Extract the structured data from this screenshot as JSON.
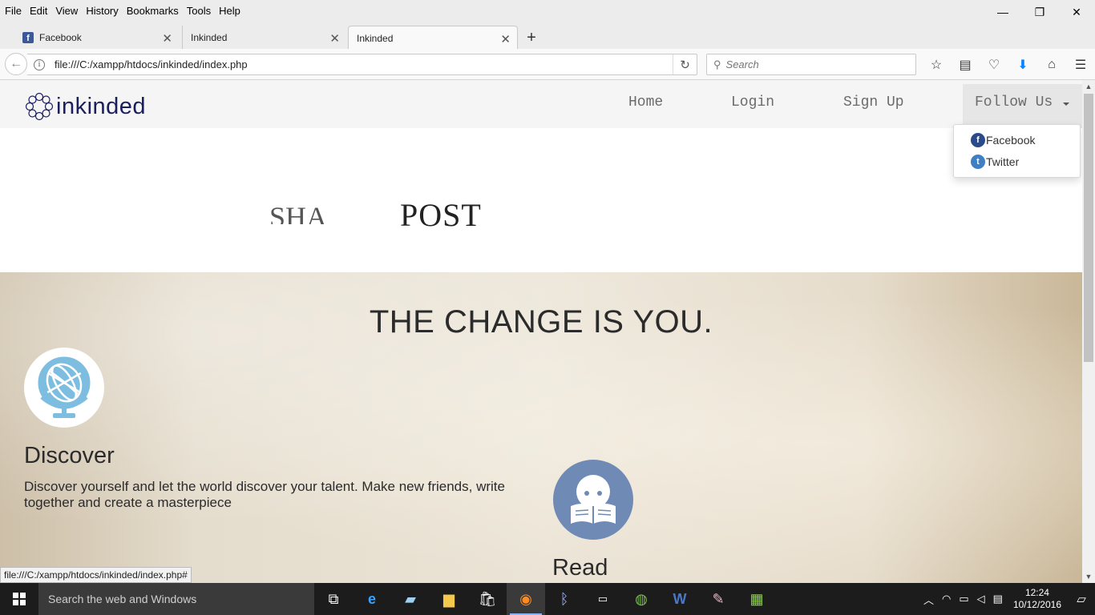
{
  "browser": {
    "menu": [
      "File",
      "Edit",
      "View",
      "History",
      "Bookmarks",
      "Tools",
      "Help"
    ],
    "window_controls": {
      "minimize": "—",
      "restore": "❐",
      "close": "✕"
    },
    "tabs": [
      {
        "title": "Facebook",
        "favicon": "facebook-favicon"
      },
      {
        "title": "Inkinded"
      },
      {
        "title": "Inkinded",
        "active": true
      }
    ],
    "new_tab": "+",
    "url": "file:///C:/xampp/htdocs/inkinded/index.php",
    "search_placeholder": "Search"
  },
  "site": {
    "logo_text": "inkinded",
    "nav": {
      "home": "Home",
      "login": "Login",
      "signup": "Sign Up",
      "follow": "Follow Us"
    },
    "follow_menu": [
      {
        "label": "Facebook",
        "icon": "facebook-icon"
      },
      {
        "label": "Twitter",
        "icon": "twitter-icon"
      }
    ],
    "hero_words": {
      "share": "SHA",
      "post": "POST"
    },
    "section_title": "THE CHANGE IS YOU.",
    "features": [
      {
        "title": "Discover",
        "text": "Discover yourself and let the world discover your talent. Make new friends, write together and create a masterpiece",
        "icon": "globe-icon"
      },
      {
        "title": "Read",
        "icon": "reader-icon"
      }
    ]
  },
  "status_bar": "file:///C:/xampp/htdocs/inkinded/index.php#",
  "taskbar": {
    "search_placeholder": "Search the web and Windows",
    "time": "12:24",
    "date": "10/12/2016"
  },
  "colors": {
    "logo": "#1b1e5e",
    "globe": "#7dbde0",
    "reader": "#6f8ab5",
    "facebook": "#2a4a8a",
    "twitter": "#3f7fc2"
  }
}
